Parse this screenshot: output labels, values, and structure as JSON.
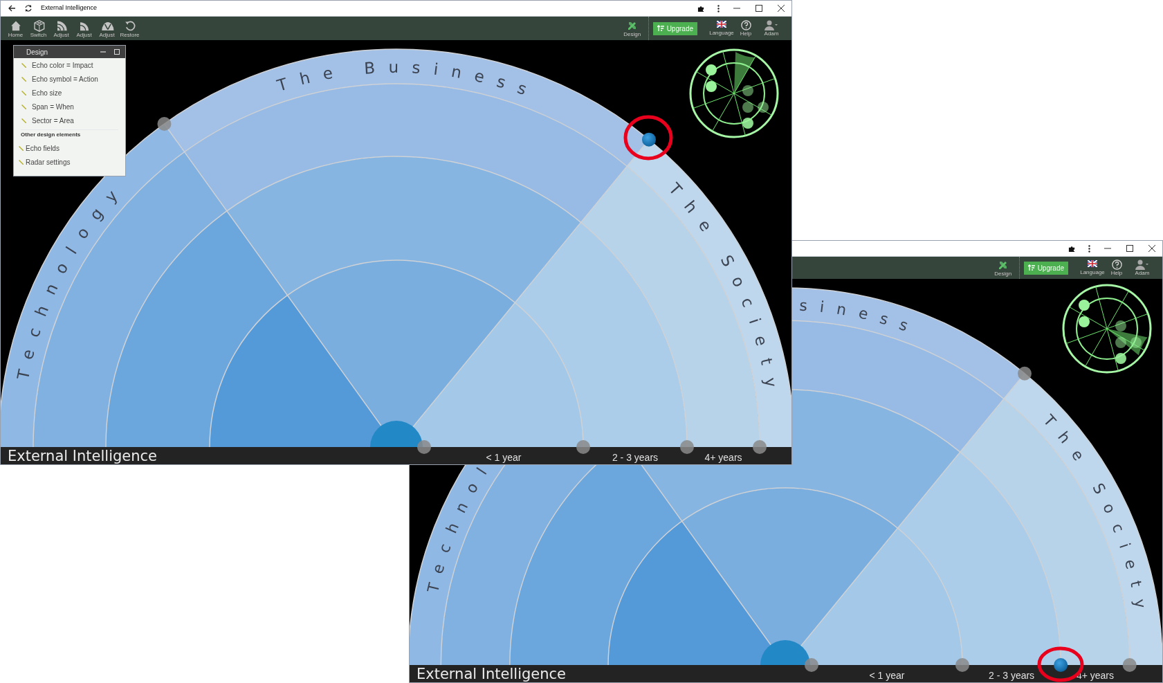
{
  "windows": [
    {
      "title": "External Intelligence",
      "toolbar_left": [
        {
          "label": "Home"
        },
        {
          "label": "Switch"
        },
        {
          "label": "Adjust"
        },
        {
          "label": "Adjust"
        },
        {
          "label": "Adjust"
        },
        {
          "label": "Restore"
        }
      ],
      "toolbar_right": {
        "design": "Design",
        "upgrade": "Upgrade",
        "language": "Language",
        "help": "Help",
        "user": "Adam"
      },
      "design_panel": {
        "title": "Design",
        "items": [
          "Echo color = Impact",
          "Echo symbol = Action",
          "Echo size",
          "Span = When",
          "Sector = Area"
        ],
        "section": "Other design elements",
        "other_items": [
          "Echo fields",
          "Radar settings"
        ]
      },
      "radar": {
        "sectors": [
          {
            "label": "Technology"
          },
          {
            "label": "The Business"
          },
          {
            "label": "The Society"
          }
        ]
      },
      "footer": {
        "title": "External Intelligence",
        "spans": [
          "< 1 year",
          "2 - 3 years",
          "4+ years"
        ]
      }
    },
    {
      "toolbar_right": {
        "design": "Design",
        "upgrade": "Upgrade",
        "language": "Language",
        "help": "Help",
        "user": "Adam"
      },
      "radar": {
        "sectors": [
          {
            "label": "Technol"
          },
          {
            "label": "siness"
          },
          {
            "label": "The Society"
          }
        ]
      },
      "footer": {
        "title": "External Intelligence",
        "spans": [
          "< 1 year",
          "2 - 3 years",
          "4+ years"
        ]
      }
    }
  ]
}
